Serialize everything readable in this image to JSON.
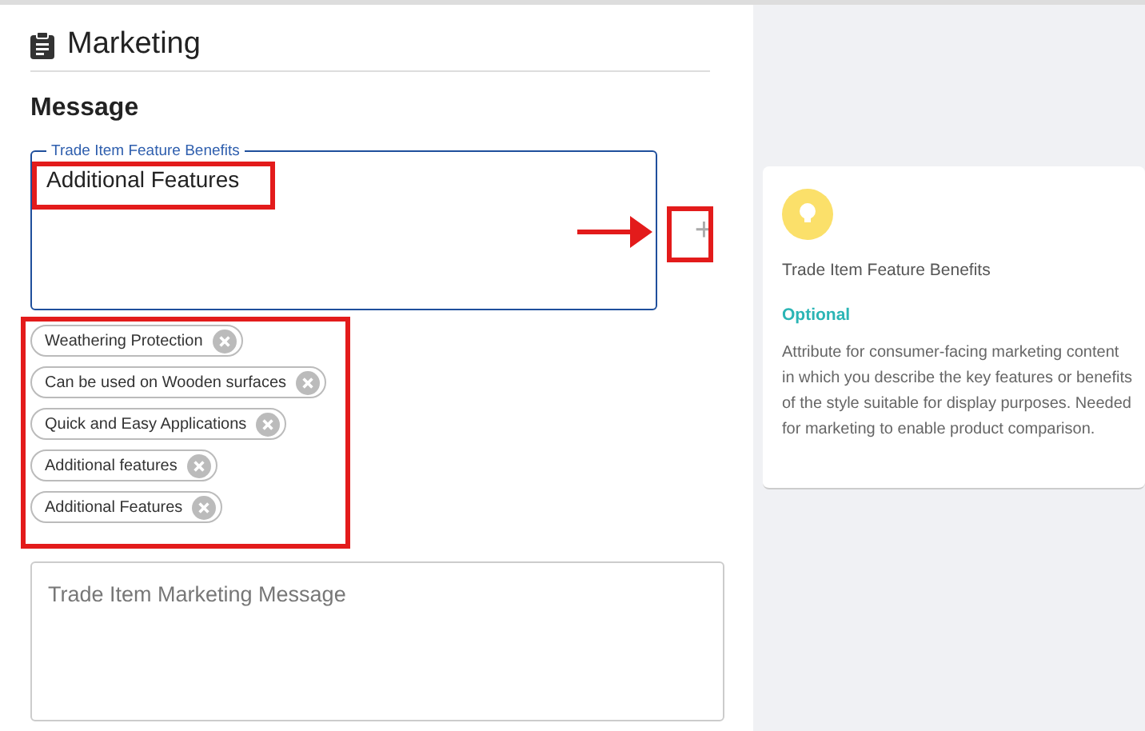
{
  "section": {
    "title": "Marketing"
  },
  "group": {
    "title": "Message"
  },
  "feature_field": {
    "label": "Trade Item Feature Benefits",
    "value": "Additional Features",
    "add_button": "+"
  },
  "chips": [
    {
      "label": "Weathering Protection"
    },
    {
      "label": "Can be used on Wooden surfaces"
    },
    {
      "label": "Quick and Easy Applications"
    },
    {
      "label": "Additional features"
    },
    {
      "label": "Additional Features"
    }
  ],
  "message_field": {
    "placeholder": "Trade Item Marketing Message"
  },
  "help_card": {
    "title": "Trade Item Feature Benefits",
    "status": "Optional",
    "description": "Attribute for consumer-facing marketing content in which you describe the key features or benefits of the style suitable for display purposes. Needed for marketing to enable product comparison."
  }
}
